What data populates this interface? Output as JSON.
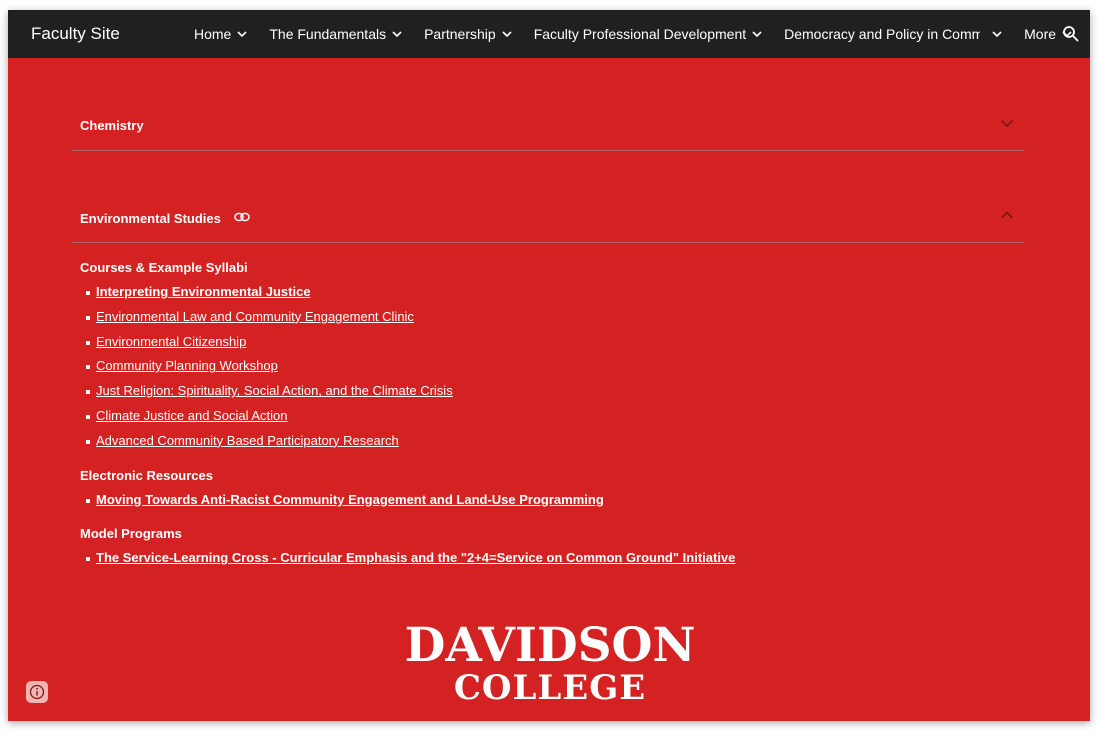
{
  "site": {
    "title": "Faculty Site"
  },
  "nav": {
    "items": [
      {
        "label": "Home"
      },
      {
        "label": "The Fundamentals"
      },
      {
        "label": "Partnership"
      },
      {
        "label": "Faculty Professional Development"
      },
      {
        "label": "Democracy and Policy in Comm…"
      },
      {
        "label": "More"
      }
    ],
    "search_icon": "search-icon"
  },
  "sections": [
    {
      "title": "Chemistry",
      "state": "collapsed",
      "toggle_icon": "chevron-down-icon"
    },
    {
      "title": "Environmental Studies",
      "state": "expanded",
      "toggle_icon": "chevron-up-icon",
      "link_icon": "link-icon"
    }
  ],
  "groups": [
    {
      "title": "Courses & Example Syllabi",
      "links": [
        {
          "label": "Interpreting Environmental Justice",
          "bold": true
        },
        {
          "label": "Environmental Law and Community Engagement Clinic",
          "bold": false
        },
        {
          "label": "Environmental Citizenship",
          "bold": false
        },
        {
          "label": "Community Planning Workshop",
          "bold": false
        },
        {
          "label": "Just Religion: Spirituality, Social Action, and the Climate Crisis",
          "bold": false
        },
        {
          "label": "Climate Justice and Social Action",
          "bold": false
        },
        {
          "label": "Advanced Community Based Participatory Research",
          "bold": false
        }
      ]
    },
    {
      "title": "Electronic Resources",
      "links": [
        {
          "label": "Moving Towards Anti-Racist Community Engagement and Land-Use Programming",
          "bold": true
        }
      ]
    },
    {
      "title": "Model Programs",
      "links": [
        {
          "label": "The Service-Learning Cross - Curricular Emphasis and the \"2+4=Service on Common Ground\" Initiative",
          "bold": true
        }
      ]
    }
  ],
  "footer": {
    "logo_line1": "DAVIDSON",
    "logo_line2": "COLLEGE",
    "info_icon": "info-icon"
  },
  "colors": {
    "background": "#d42222",
    "topbar": "#202020",
    "text": "#ffffff"
  }
}
